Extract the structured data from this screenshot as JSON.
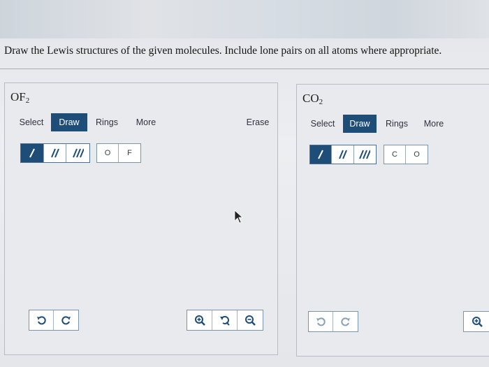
{
  "instruction": "Draw the Lewis structures of the given molecules. Include lone pairs on all atoms where appropriate.",
  "panels": [
    {
      "formula_main": "OF",
      "formula_sub": "2",
      "toolbar": {
        "select": "Select",
        "draw": "Draw",
        "rings": "Rings",
        "more": "More",
        "erase": "Erase"
      },
      "elements": [
        "O",
        "F"
      ]
    },
    {
      "formula_main": "CO",
      "formula_sub": "2",
      "toolbar": {
        "select": "Select",
        "draw": "Draw",
        "rings": "Rings",
        "more": "More"
      },
      "elements": [
        "C",
        "O"
      ]
    }
  ],
  "icons": [
    "single-bond-icon",
    "double-bond-icon",
    "triple-bond-icon",
    "undo-icon",
    "redo-icon",
    "zoom-in-icon",
    "zoom-reset-icon",
    "zoom-out-icon",
    "mouse-cursor-icon"
  ],
  "colors": {
    "accent": "#1e4d78",
    "panel_bg": "#e9eaee"
  }
}
